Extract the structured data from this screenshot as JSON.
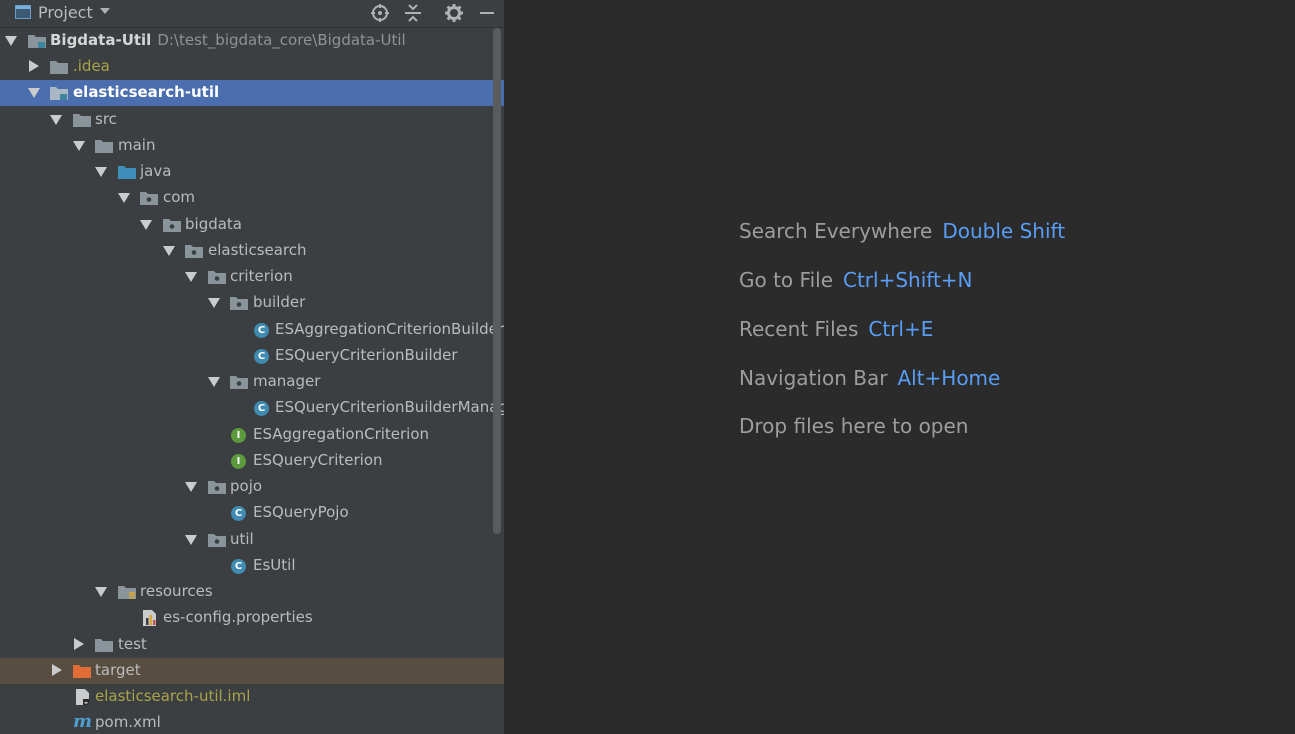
{
  "toolbar": {
    "title": "Project",
    "buttons": [
      "locate-icon",
      "collapse-icon",
      "gear-icon",
      "minimize-icon"
    ]
  },
  "tree": {
    "root": {
      "name": "Bigdata-Util",
      "path": "D:\\test_bigdata_core\\Bigdata-Util"
    },
    "idea": ".idea",
    "module": "elasticsearch-util",
    "src": "src",
    "main": "main",
    "java": "java",
    "com": "com",
    "bigdata": "bigdata",
    "elasticsearch": "elasticsearch",
    "criterion": "criterion",
    "builder": "builder",
    "es_aggregation_criterion_builder": "ESAggregationCriterionBuilder",
    "es_query_criterion_builder": "ESQueryCriterionBuilder",
    "manager": "manager",
    "es_query_criterion_builder_manager": "ESQueryCriterionBuilderManage",
    "es_aggregation_criterion": "ESAggregationCriterion",
    "es_query_criterion": "ESQueryCriterion",
    "pojo": "pojo",
    "es_query_pojo": "ESQueryPojo",
    "util": "util",
    "es_util": "EsUtil",
    "resources": "resources",
    "es_config": "es-config.properties",
    "test": "test",
    "target": "target",
    "iml": "elasticsearch-util.iml",
    "pom": "pom.xml"
  },
  "editor": {
    "hints": [
      {
        "action": "Search Everywhere",
        "shortcut": "Double Shift"
      },
      {
        "action": "Go to File",
        "shortcut": "Ctrl+Shift+N"
      },
      {
        "action": "Recent Files",
        "shortcut": "Ctrl+E"
      },
      {
        "action": "Navigation Bar",
        "shortcut": "Alt+Home"
      }
    ],
    "drop_text": "Drop files here to open"
  },
  "colors": {
    "panel_bg": "#3c3f41",
    "editor_bg": "#2b2b2b",
    "selection": "#4b6eaf",
    "excluded": "#574d41",
    "shortcut": "#589df6",
    "class_icon": "#3f8bb1",
    "interface_icon": "#5c9a3b"
  }
}
